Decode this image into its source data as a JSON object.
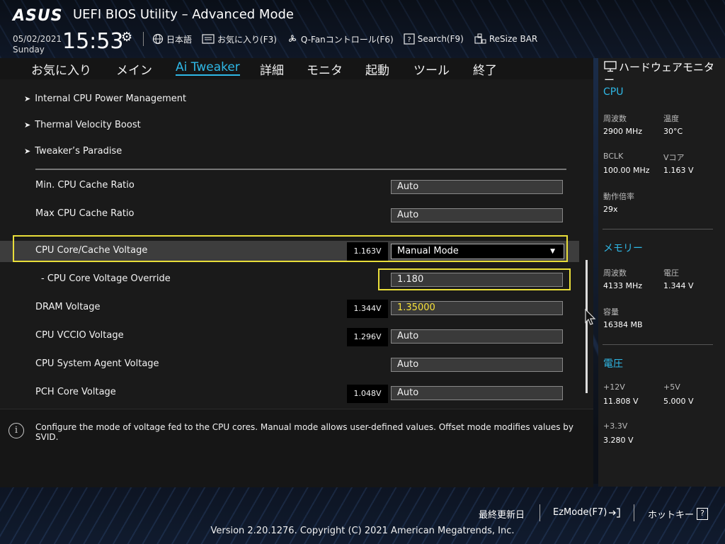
{
  "header": {
    "logo": "ASUS",
    "title": "UEFI BIOS Utility – Advanced Mode",
    "date": "05/02/2021",
    "day": "Sunday",
    "time": "15:53",
    "toolbar": {
      "language": "日本語",
      "favorites": "お気に入り(F3)",
      "qfan": "Q-Fanコントロール(F6)",
      "search": "Search(F9)",
      "resize": "ReSize BAR"
    }
  },
  "menu": {
    "tabs": [
      "お気に入り",
      "メイン",
      "Ai Tweaker",
      "詳細",
      "モニタ",
      "起動",
      "ツール",
      "終了"
    ],
    "active": "Ai Tweaker"
  },
  "submenus": [
    "Internal CPU Power Management",
    "Thermal Velocity Boost",
    "Tweaker’s Paradise"
  ],
  "settings": [
    {
      "label": "Min. CPU Cache Ratio",
      "value": "Auto",
      "reading": ""
    },
    {
      "label": "Max CPU Cache Ratio",
      "value": "Auto",
      "reading": ""
    },
    {
      "label": "CPU Core/Cache Voltage",
      "value": "Manual Mode",
      "reading": "1.163V"
    },
    {
      "label": "- CPU Core Voltage Override",
      "value": "1.180",
      "reading": ""
    },
    {
      "label": "DRAM Voltage",
      "value": "1.35000",
      "reading": "1.344V"
    },
    {
      "label": "CPU VCCIO Voltage",
      "value": "Auto",
      "reading": "1.296V"
    },
    {
      "label": "CPU System Agent Voltage",
      "value": "Auto",
      "reading": ""
    },
    {
      "label": "PCH Core Voltage",
      "value": "Auto",
      "reading": "1.048V"
    }
  ],
  "help_text": "Configure the mode of voltage fed to the CPU cores. Manual mode allows user-defined values. Offset mode modifies values by SVID.",
  "hw_monitor": {
    "title": "ハードウェアモニター",
    "cpu": {
      "section": "CPU",
      "freq_label": "周波数",
      "freq": "2900 MHz",
      "temp_label": "温度",
      "temp": "30°C",
      "bclk_label": "BCLK",
      "bclk": "100.00 MHz",
      "vcore_label": "Vコア",
      "vcore": "1.163 V",
      "ratio_label": "動作倍率",
      "ratio": "29x"
    },
    "memory": {
      "section": "メモリー",
      "freq_label": "周波数",
      "freq": "4133 MHz",
      "volt_label": "電圧",
      "volt": "1.344 V",
      "cap_label": "容量",
      "cap": "16384 MB"
    },
    "voltage": {
      "section": "電圧",
      "v12_label": "+12V",
      "v12": "11.808 V",
      "v5_label": "+5V",
      "v5": "5.000 V",
      "v33_label": "+3.3V",
      "v33": "3.280 V"
    }
  },
  "footer": {
    "last_modified": "最終更新日",
    "ezmode": "EzMode(F7)",
    "hotkeys": "ホットキー",
    "hotkey_symbol": "?",
    "copyright": "Version 2.20.1276. Copyright (C) 2021 American Megatrends, Inc."
  },
  "colors": {
    "accent": "#2fb8e6",
    "highlight": "#e9de3a",
    "value_yellow": "#f6e13a"
  }
}
